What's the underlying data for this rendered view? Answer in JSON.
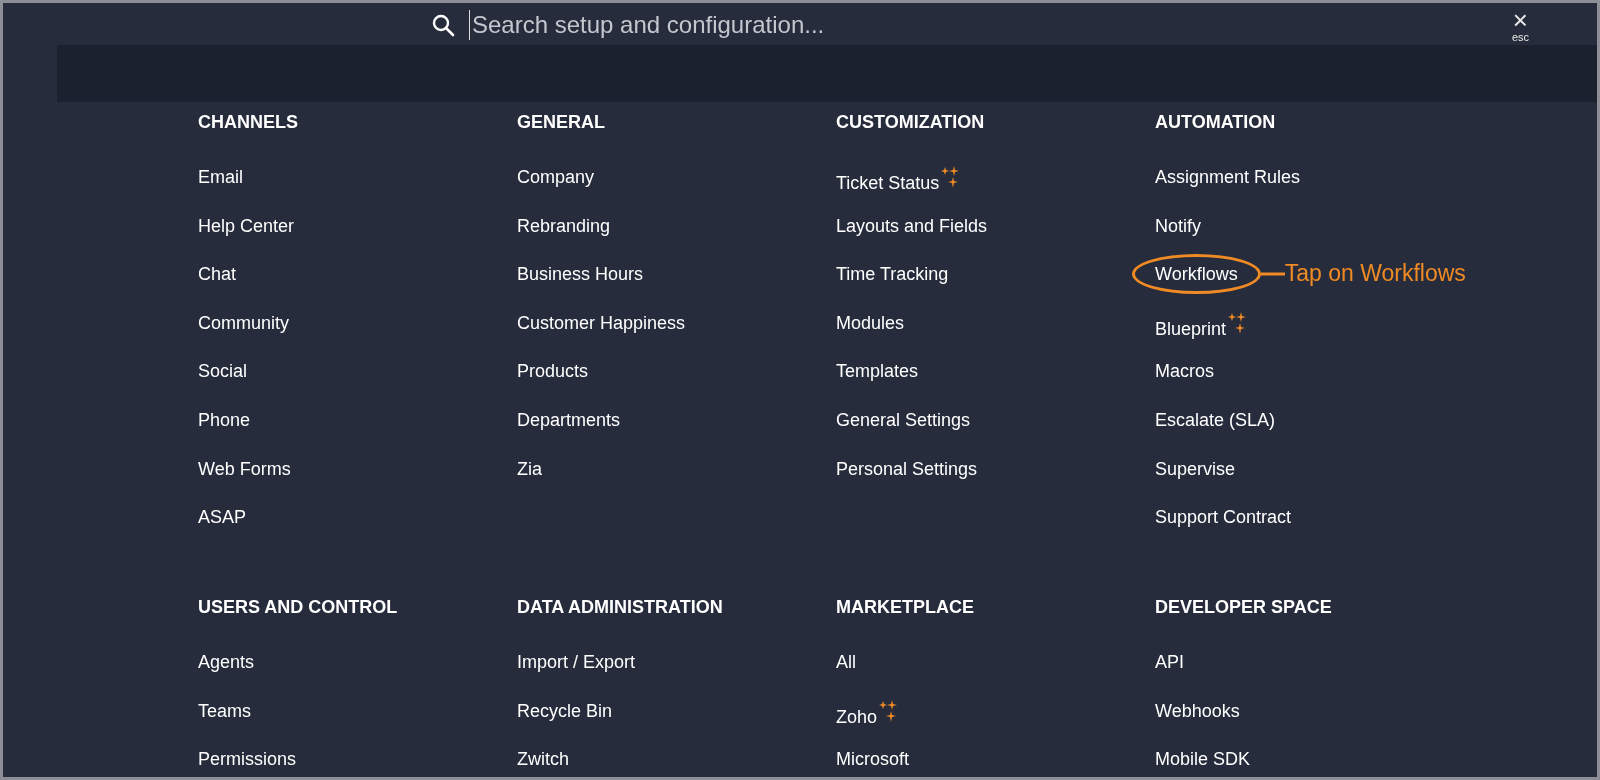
{
  "search": {
    "placeholder": "Search setup and configuration..."
  },
  "close": {
    "label": "×",
    "hint": "esc"
  },
  "sections": [
    {
      "title": "CHANNELS",
      "items": [
        {
          "label": "Email",
          "new": false,
          "highlighted": false
        },
        {
          "label": "Help Center",
          "new": false,
          "highlighted": false
        },
        {
          "label": "Chat",
          "new": false,
          "highlighted": false
        },
        {
          "label": "Community",
          "new": false,
          "highlighted": false
        },
        {
          "label": "Social",
          "new": false,
          "highlighted": false
        },
        {
          "label": "Phone",
          "new": false,
          "highlighted": false
        },
        {
          "label": "Web Forms",
          "new": false,
          "highlighted": false
        },
        {
          "label": "ASAP",
          "new": false,
          "highlighted": false
        }
      ]
    },
    {
      "title": "GENERAL",
      "items": [
        {
          "label": "Company",
          "new": false,
          "highlighted": false
        },
        {
          "label": "Rebranding",
          "new": false,
          "highlighted": false
        },
        {
          "label": "Business Hours",
          "new": false,
          "highlighted": false
        },
        {
          "label": "Customer Happiness",
          "new": false,
          "highlighted": false
        },
        {
          "label": "Products",
          "new": false,
          "highlighted": false
        },
        {
          "label": "Departments",
          "new": false,
          "highlighted": false
        },
        {
          "label": "Zia",
          "new": false,
          "highlighted": false
        }
      ]
    },
    {
      "title": "CUSTOMIZATION",
      "items": [
        {
          "label": "Ticket Status",
          "new": true,
          "highlighted": false
        },
        {
          "label": "Layouts and Fields",
          "new": false,
          "highlighted": false
        },
        {
          "label": "Time Tracking",
          "new": false,
          "highlighted": false
        },
        {
          "label": "Modules",
          "new": false,
          "highlighted": false
        },
        {
          "label": "Templates",
          "new": false,
          "highlighted": false
        },
        {
          "label": "General Settings",
          "new": false,
          "highlighted": false
        },
        {
          "label": "Personal Settings",
          "new": false,
          "highlighted": false
        }
      ]
    },
    {
      "title": "AUTOMATION",
      "items": [
        {
          "label": "Assignment Rules",
          "new": false,
          "highlighted": false
        },
        {
          "label": "Notify",
          "new": false,
          "highlighted": false
        },
        {
          "label": "Workflows",
          "new": false,
          "highlighted": true
        },
        {
          "label": "Blueprint",
          "new": true,
          "highlighted": false
        },
        {
          "label": "Macros",
          "new": false,
          "highlighted": false
        },
        {
          "label": "Escalate (SLA)",
          "new": false,
          "highlighted": false
        },
        {
          "label": "Supervise",
          "new": false,
          "highlighted": false
        },
        {
          "label": "Support Contract",
          "new": false,
          "highlighted": false
        }
      ]
    },
    {
      "title": "USERS AND CONTROL",
      "items": [
        {
          "label": "Agents",
          "new": false,
          "highlighted": false
        },
        {
          "label": "Teams",
          "new": false,
          "highlighted": false
        },
        {
          "label": "Permissions",
          "new": false,
          "highlighted": false
        }
      ]
    },
    {
      "title": "DATA ADMINISTRATION",
      "items": [
        {
          "label": "Import / Export",
          "new": false,
          "highlighted": false
        },
        {
          "label": "Recycle Bin",
          "new": false,
          "highlighted": false
        },
        {
          "label": "Zwitch",
          "new": false,
          "highlighted": false
        }
      ]
    },
    {
      "title": "MARKETPLACE",
      "items": [
        {
          "label": "All",
          "new": false,
          "highlighted": false
        },
        {
          "label": "Zoho",
          "new": true,
          "highlighted": false
        },
        {
          "label": "Microsoft",
          "new": false,
          "highlighted": false
        }
      ]
    },
    {
      "title": "DEVELOPER SPACE",
      "items": [
        {
          "label": "API",
          "new": false,
          "highlighted": false
        },
        {
          "label": "Webhooks",
          "new": false,
          "highlighted": false
        },
        {
          "label": "Mobile SDK",
          "new": false,
          "highlighted": false
        }
      ]
    }
  ],
  "annotation": {
    "text": "Tap on Workflows"
  }
}
